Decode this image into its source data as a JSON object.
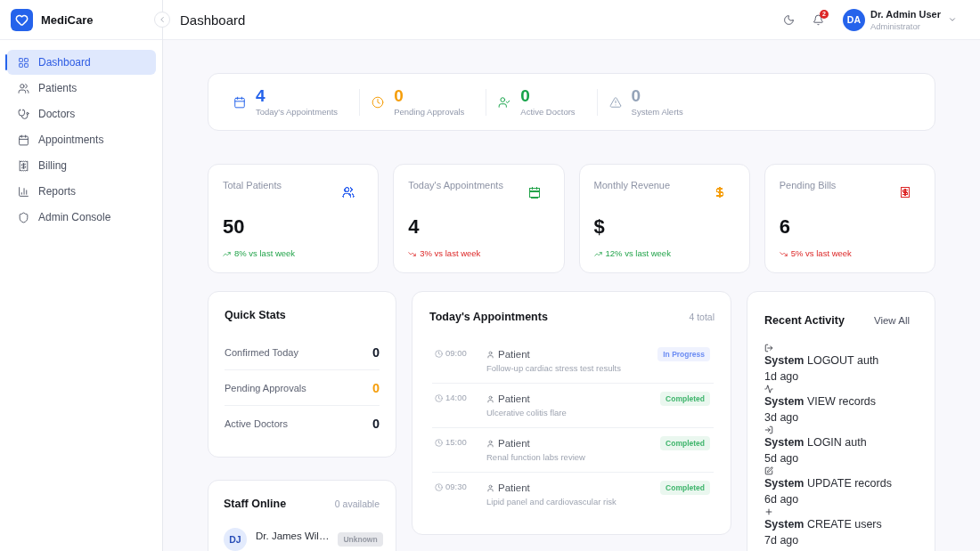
{
  "sidebar": {
    "brand": "MediCare",
    "items": [
      {
        "label": "Dashboard",
        "selected": true
      },
      {
        "label": "Patients",
        "selected": false
      },
      {
        "label": "Doctors",
        "selected": false
      },
      {
        "label": "Appointments",
        "selected": false
      },
      {
        "label": "Billing",
        "selected": false
      },
      {
        "label": "Reports",
        "selected": false
      },
      {
        "label": "Admin Console",
        "selected": false
      }
    ]
  },
  "header": {
    "title": "Dashboard",
    "notification_count": "2",
    "user": {
      "initials": "DA",
      "name": "Dr. Admin User",
      "role": "Administrator"
    }
  },
  "summary_strip": [
    {
      "value": "4",
      "label": "Today's Appointments",
      "color": "#2563eb"
    },
    {
      "value": "0",
      "label": "Pending Approvals",
      "color": "#f59e0b"
    },
    {
      "value": "0",
      "label": "Active Doctors",
      "color": "#16a34a"
    },
    {
      "value": "0",
      "label": "System Alerts",
      "color": "#94a3b8"
    }
  ],
  "stat_cards": [
    {
      "title": "Total Patients",
      "value": "50",
      "trend": "8% vs last week",
      "rising": true,
      "color": "#3b6cf0"
    },
    {
      "title": "Today's Appointments",
      "value": "4",
      "trend": "3% vs last week",
      "rising": false,
      "color": "#22a34a"
    },
    {
      "title": "Monthly Revenue",
      "value": "$",
      "trend": "12% vs last week",
      "rising": true,
      "color": "#f59e0b"
    },
    {
      "title": "Pending Bills",
      "value": "6",
      "trend": "5% vs last week",
      "rising": false,
      "color": "#dc2626"
    }
  ],
  "quick_stats": {
    "title": "Quick Stats",
    "rows": [
      {
        "label": "Confirmed Today",
        "value": "0",
        "color": "#111827"
      },
      {
        "label": "Pending Approvals",
        "value": "0",
        "color": "#f59e0b"
      },
      {
        "label": "Active Doctors",
        "value": "0",
        "color": "#111827"
      }
    ]
  },
  "staff_online": {
    "title": "Staff Online",
    "count": "0 available",
    "members": [
      {
        "initials": "DJ",
        "name": "Dr. James Wil…",
        "status": "Unknown"
      }
    ]
  },
  "appointments": {
    "title": "Today's Appointments",
    "count": "4 total",
    "rows": [
      {
        "time": "09:00",
        "patient": "Patient",
        "note": "Follow-up cardiac stress test results",
        "status": "In Progress",
        "color": "#6b8cf3"
      },
      {
        "time": "14:00",
        "patient": "Patient",
        "note": "Ulcerative colitis flare",
        "status": "Completed",
        "color": "#3fb56c"
      },
      {
        "time": "15:00",
        "patient": "Patient",
        "note": "Renal function labs review",
        "status": "Completed",
        "color": "#3fb56c"
      },
      {
        "time": "09:30",
        "patient": "Patient",
        "note": "Lipid panel and cardiovascular risk",
        "status": "Completed",
        "color": "#3fb56c"
      }
    ]
  },
  "recent_activity": {
    "title": "Recent Activity",
    "action": "View All",
    "items": [
      {
        "text": "**System** LOGOUT auth",
        "time": "1d ago"
      },
      {
        "text": "**System** VIEW records",
        "time": "3d ago"
      },
      {
        "text": "**System** LOGIN auth",
        "time": "5d ago"
      },
      {
        "text": "**System** UPDATE records",
        "time": "6d ago"
      },
      {
        "text": "**System** CREATE users",
        "time": "7d ago"
      }
    ]
  }
}
